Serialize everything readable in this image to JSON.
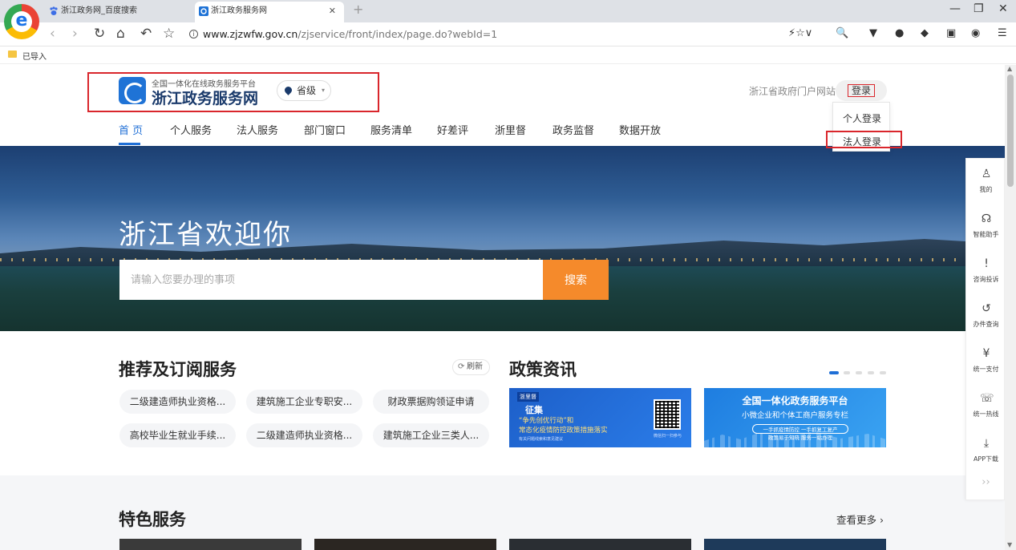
{
  "browser": {
    "logo_letter": "e",
    "tabs": [
      {
        "title": "浙江政务网_百度搜索",
        "close": ""
      },
      {
        "title": "浙江政务服务网",
        "close": "✕"
      }
    ],
    "new_tab": "+",
    "window_controls": [
      "—",
      "❐",
      "✕"
    ],
    "nav": {
      "back": "‹",
      "forward": "›",
      "reload": "↻",
      "home": "⌂",
      "undo": "↶",
      "star": "☆"
    },
    "url_host": "www.zjzwfw.gov.cn",
    "url_path": "/zjservice/front/index/page.do?webId=1",
    "bookmark": "已导入",
    "tools": [
      "⚡☆∨",
      "🔍",
      "▼",
      "●",
      "◆",
      "▣",
      "◉",
      "☰"
    ]
  },
  "header": {
    "brand_sub": "全国一体化在线政务服务平台",
    "brand_name": "浙江政务服务网",
    "region": "省级",
    "region_caret": "▾",
    "portal_link": "浙江省政府门户网站",
    "login": "登录",
    "login_menu": [
      "个人登录",
      "法人登录"
    ]
  },
  "nav": [
    "首 页",
    "个人服务",
    "法人服务",
    "部门窗口",
    "服务清单",
    "好差评",
    "浙里督",
    "政务监督",
    "数据开放"
  ],
  "hero": {
    "title": "浙江省欢迎你",
    "search_placeholder": "请输入您要办理的事项",
    "search_button": "搜索"
  },
  "recommend": {
    "title": "推荐及订阅服务",
    "refresh": "刷新",
    "items": [
      "二级建造师执业资格...",
      "建筑施工企业专职安...",
      "财政票据购领证申请",
      "高校毕业生就业手续...",
      "二级建造师执业资格...",
      "建筑施工企业三类人..."
    ]
  },
  "policy": {
    "title": "政策资讯",
    "banner1": {
      "tag": "浙里督",
      "headline": "征集",
      "line1": "“争先创优行动”和",
      "line2": "常态化疫情防控政策措施落实",
      "line3": "有关问题线索和意见建议",
      "qr_caption": "微信扫一扫参与"
    },
    "banner2": {
      "t1": "全国一体化政务服务平台",
      "t2": "小微企业和个体工商户服务专栏",
      "t3": "一手抓疫情防控 一手抓复工复产",
      "t4": "政策易于知晓 服务一站办理"
    }
  },
  "special": {
    "title": "特色服务",
    "more": "查看更多 ›"
  },
  "sidebar": [
    {
      "icon": "user-icon",
      "glyph": "♙",
      "label": "我的"
    },
    {
      "icon": "headset-icon",
      "glyph": "☊",
      "label": "智能助手"
    },
    {
      "icon": "shield-icon",
      "glyph": "!",
      "label": "咨询投诉"
    },
    {
      "icon": "history-icon",
      "glyph": "↺",
      "label": "办件查询"
    },
    {
      "icon": "yen-icon",
      "glyph": "¥",
      "label": "统一支付"
    },
    {
      "icon": "phone-icon",
      "glyph": "☏",
      "label": "统一热线"
    },
    {
      "icon": "download-icon",
      "glyph": "⤓",
      "label": "APP下载"
    }
  ],
  "sidebar_more": "››",
  "colors": {
    "accent": "#1f6fd6",
    "search_button": "#f58a2b",
    "highlight_box": "#d9262c"
  }
}
